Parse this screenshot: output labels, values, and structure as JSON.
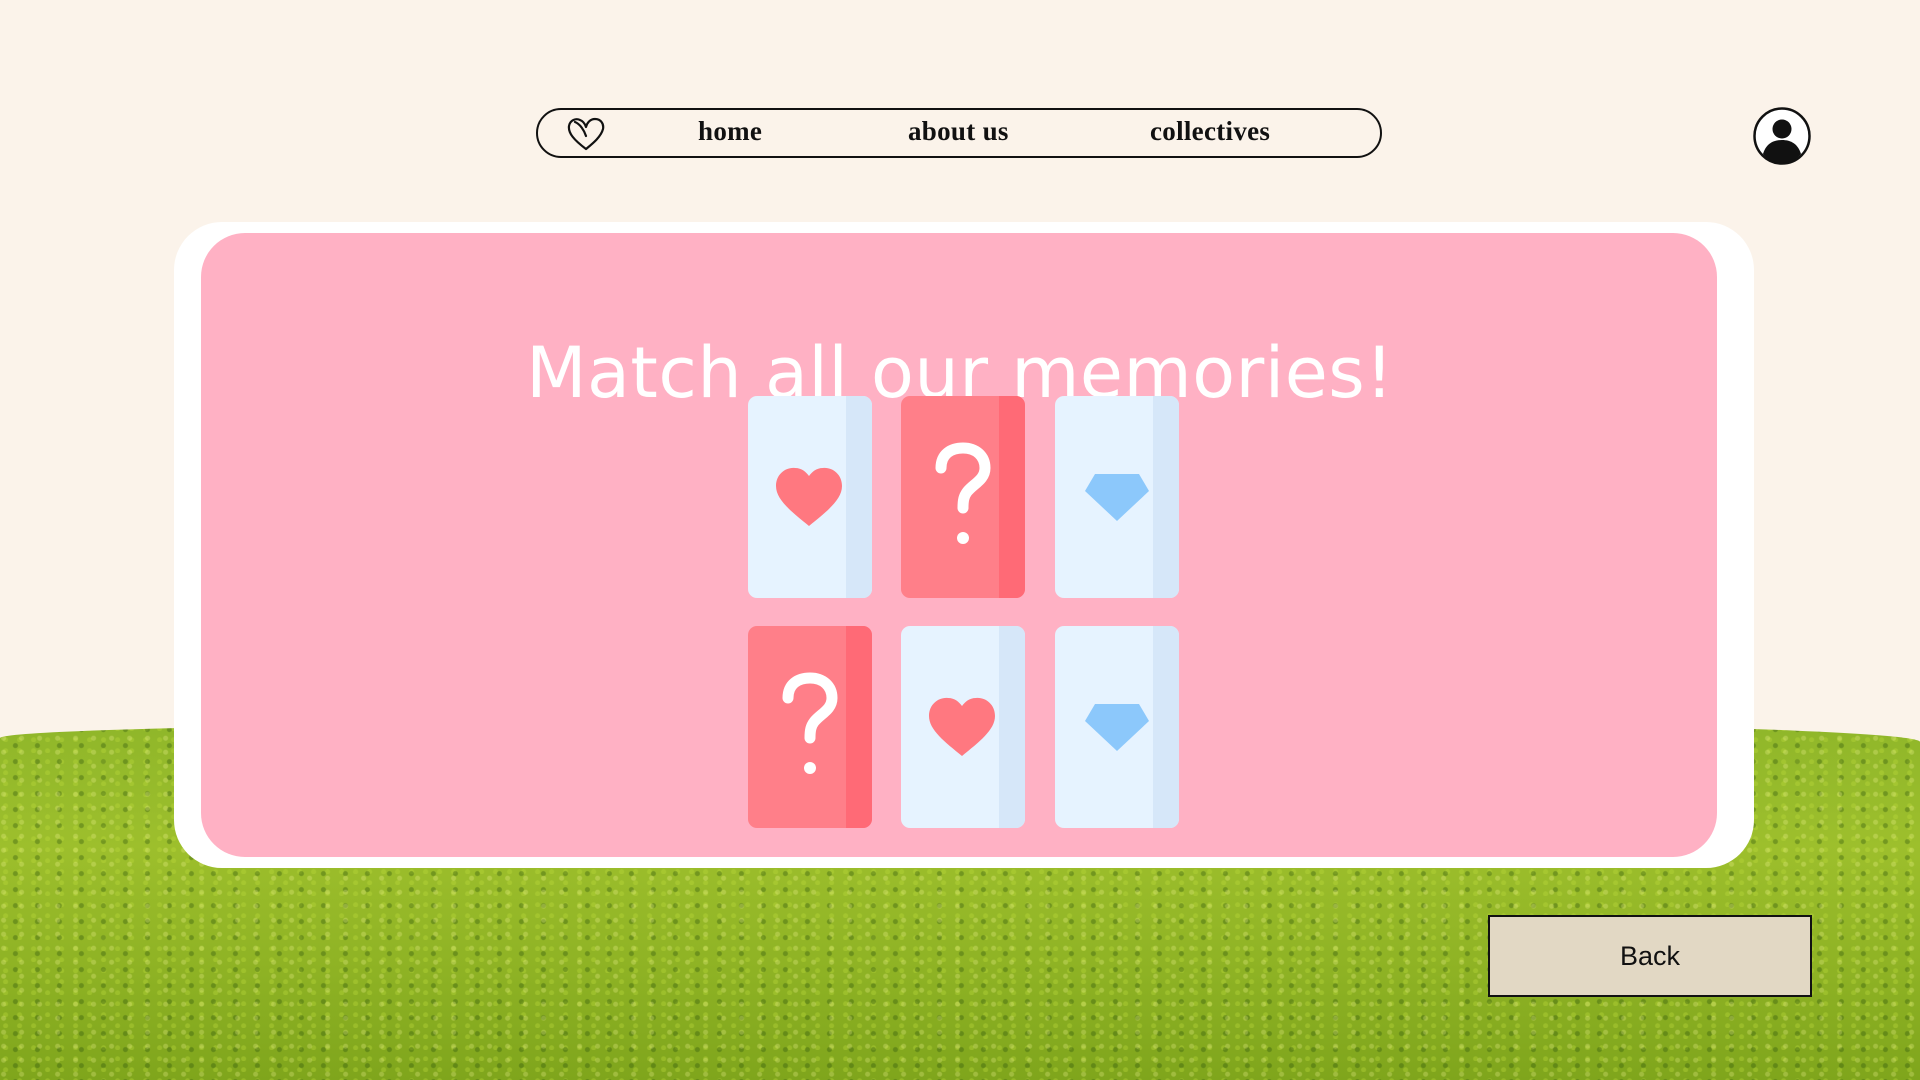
{
  "nav": {
    "logo_icon": "heart-outline-icon",
    "links": [
      {
        "label": "home"
      },
      {
        "label": "about us"
      },
      {
        "label": "collectives"
      }
    ],
    "account_icon": "user-account-icon"
  },
  "game": {
    "title": "Match all our memories!",
    "cards": [
      {
        "state": "revealed",
        "symbol": "heart-icon"
      },
      {
        "state": "hidden",
        "symbol": "question-mark-icon"
      },
      {
        "state": "revealed",
        "symbol": "diamond-icon"
      },
      {
        "state": "hidden",
        "symbol": "question-mark-icon"
      },
      {
        "state": "revealed",
        "symbol": "heart-icon"
      },
      {
        "state": "revealed",
        "symbol": "diamond-icon"
      }
    ]
  },
  "actions": {
    "back_label": "Back"
  },
  "colors": {
    "background": "#fbf3ea",
    "panel_pink": "#ffb1c4",
    "card_face": "#e6f3ff",
    "card_back": "#ff7f89",
    "heart": "#ff7880",
    "diamond": "#8cc8fb",
    "back_button": "#e2d8c4"
  }
}
